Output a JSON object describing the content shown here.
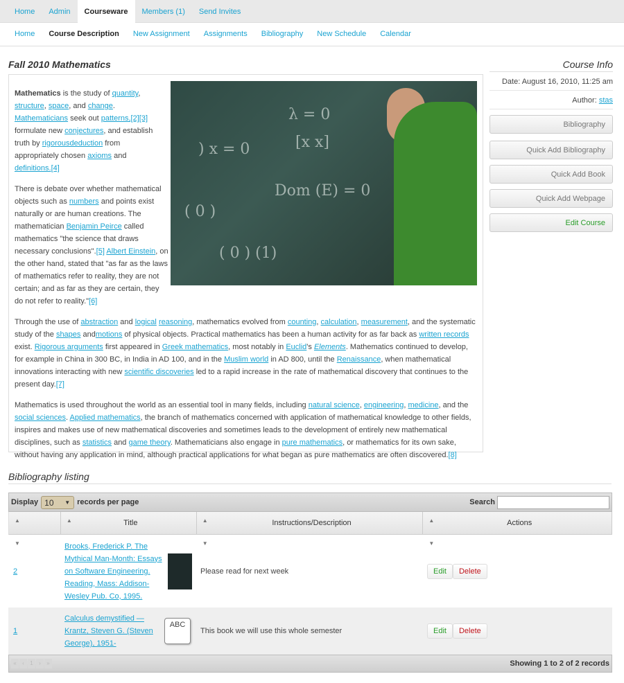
{
  "topnav": [
    "Home",
    "Admin",
    "Courseware",
    "Members (1)",
    "Send Invites"
  ],
  "subnav": [
    "Home",
    "Course Description",
    "New Assignment",
    "Assignments",
    "Bibliography",
    "New Schedule",
    "Calendar"
  ],
  "page_title": "Fall 2010 Mathematics",
  "paragraphs": [
    [
      {
        "t": "Mathematics",
        "b": 1
      },
      {
        "t": " is the study of "
      },
      {
        "t": "quantity",
        "l": 1
      },
      {
        "t": ", "
      },
      {
        "t": "structure",
        "l": 1
      },
      {
        "t": ", "
      },
      {
        "t": "space",
        "l": 1
      },
      {
        "t": ", and "
      },
      {
        "t": "change",
        "l": 1
      },
      {
        "t": ". "
      },
      {
        "t": "Mathematicians",
        "l": 1
      },
      {
        "t": " seek out "
      },
      {
        "t": "patterns",
        "l": 1
      },
      {
        "t": ",[2][3]",
        "l": 1
      },
      {
        "t": " formulate new "
      },
      {
        "t": "conjectures",
        "l": 1
      },
      {
        "t": ", and establish truth by "
      },
      {
        "t": "rigorousdeduction",
        "l": 1
      },
      {
        "t": " from appropriately chosen "
      },
      {
        "t": "axioms",
        "l": 1
      },
      {
        "t": " and "
      },
      {
        "t": "definitions",
        "l": 1
      },
      {
        "t": ".[4]",
        "l": 1
      }
    ],
    [
      {
        "t": "There is debate over whether mathematical objects such as "
      },
      {
        "t": "numbers",
        "l": 1
      },
      {
        "t": " and points exist naturally or are human creations. The mathematician "
      },
      {
        "t": "Benjamin Peirce",
        "l": 1
      },
      {
        "t": " called mathematics \"the science that draws necessary conclusions\"."
      },
      {
        "t": "[5]",
        "l": 1
      },
      {
        "t": " "
      },
      {
        "t": "Albert Einstein",
        "l": 1
      },
      {
        "t": ", on the other hand, stated that \"as far as the laws of mathematics refer to reality, they are not certain; and as far as they are certain, they do not refer to reality.\""
      },
      {
        "t": "[6]",
        "l": 1
      }
    ],
    [
      {
        "t": "Through the use of "
      },
      {
        "t": "abstraction",
        "l": 1
      },
      {
        "t": " and "
      },
      {
        "t": "logical",
        "l": 1
      },
      {
        "t": " "
      },
      {
        "t": "reasoning",
        "l": 1
      },
      {
        "t": ", mathematics evolved from "
      },
      {
        "t": "counting",
        "l": 1
      },
      {
        "t": ", "
      },
      {
        "t": "calculation",
        "l": 1
      },
      {
        "t": ", "
      },
      {
        "t": "measurement",
        "l": 1
      },
      {
        "t": ", and the systematic study of the "
      },
      {
        "t": "shapes",
        "l": 1
      },
      {
        "t": " and"
      },
      {
        "t": "motions",
        "l": 1
      },
      {
        "t": " of physical objects. Practical mathematics has been a human activity for as far back as "
      },
      {
        "t": "written records",
        "l": 1
      },
      {
        "t": " exist. "
      },
      {
        "t": "Rigorous arguments",
        "l": 1
      },
      {
        "t": " first appeared in "
      },
      {
        "t": "Greek mathematics",
        "l": 1
      },
      {
        "t": ", most notably in "
      },
      {
        "t": "Euclid",
        "l": 1
      },
      {
        "t": "'s "
      },
      {
        "t": "Elements",
        "l": 1,
        "i": 1
      },
      {
        "t": ". Mathematics continued to develop, for example in China in 300 BC, in India in AD 100, and in the "
      },
      {
        "t": "Muslim world",
        "l": 1
      },
      {
        "t": " in AD 800, until the "
      },
      {
        "t": "Renaissance",
        "l": 1
      },
      {
        "t": ", when mathematical innovations interacting with new "
      },
      {
        "t": "scientific discoveries",
        "l": 1
      },
      {
        "t": " led to a rapid increase in the rate of mathematical discovery that continues to the present day."
      },
      {
        "t": "[7]",
        "l": 1
      }
    ],
    [
      {
        "t": "Mathematics is used throughout the world as an essential tool in many fields, including "
      },
      {
        "t": "natural science",
        "l": 1
      },
      {
        "t": ", "
      },
      {
        "t": "engineering",
        "l": 1
      },
      {
        "t": ", "
      },
      {
        "t": "medicine",
        "l": 1
      },
      {
        "t": ", and the "
      },
      {
        "t": "social sciences",
        "l": 1
      },
      {
        "t": ". "
      },
      {
        "t": "Applied mathematics",
        "l": 1
      },
      {
        "t": ", the branch of mathematics concerned with application of mathematical knowledge to other fields, inspires and makes use of new mathematical discoveries and sometimes leads to the development of entirely new mathematical disciplines, such as "
      },
      {
        "t": "statistics",
        "l": 1
      },
      {
        "t": " and "
      },
      {
        "t": "game theory",
        "l": 1
      },
      {
        "t": ". Mathematicians also engage in "
      },
      {
        "t": "pure mathematics",
        "l": 1
      },
      {
        "t": ", or mathematics for its own sake, without having any application in mind, although practical applications for what began as pure mathematics are often discovered."
      },
      {
        "t": "[8]",
        "l": 1
      }
    ]
  ],
  "sidebar": {
    "title": "Course Info",
    "date": "Date: August 16, 2010, 11:25 am",
    "author_label": "Author: ",
    "author": "stas",
    "buttons": [
      "Bibliography",
      "Quick Add Bibliography",
      "Quick Add Book",
      "Quick Add Webpage",
      "Edit Course"
    ]
  },
  "biblio": {
    "title": "Bibliography listing",
    "display": "Display",
    "per_page": "10",
    "records_per_page": "records per page",
    "search": "Search",
    "search_value": "",
    "headers": [
      "",
      "Title",
      "Instructions/Description",
      "Actions"
    ],
    "rows": [
      {
        "id": "2",
        "title": "Brooks, Frederick P. The Mythical Man-Month: Essays on Software Engineering. Reading, Mass: Addison-Wesley Pub. Co, 1995.",
        "desc": "Please read for next week",
        "thumb": "book-cover",
        "edit": "Edit",
        "delete": "Delete"
      },
      {
        "id": "1",
        "title": "Calculus demystified — Krantz, Steven G. (Steven George), 1951-",
        "desc": "This book we will use this whole semester",
        "thumb": "ABC",
        "edit": "Edit",
        "delete": "Delete"
      }
    ],
    "pager": [
      "«",
      "‹",
      "1",
      "›",
      "»"
    ],
    "info": "Showing 1 to 2 of 2 records"
  }
}
